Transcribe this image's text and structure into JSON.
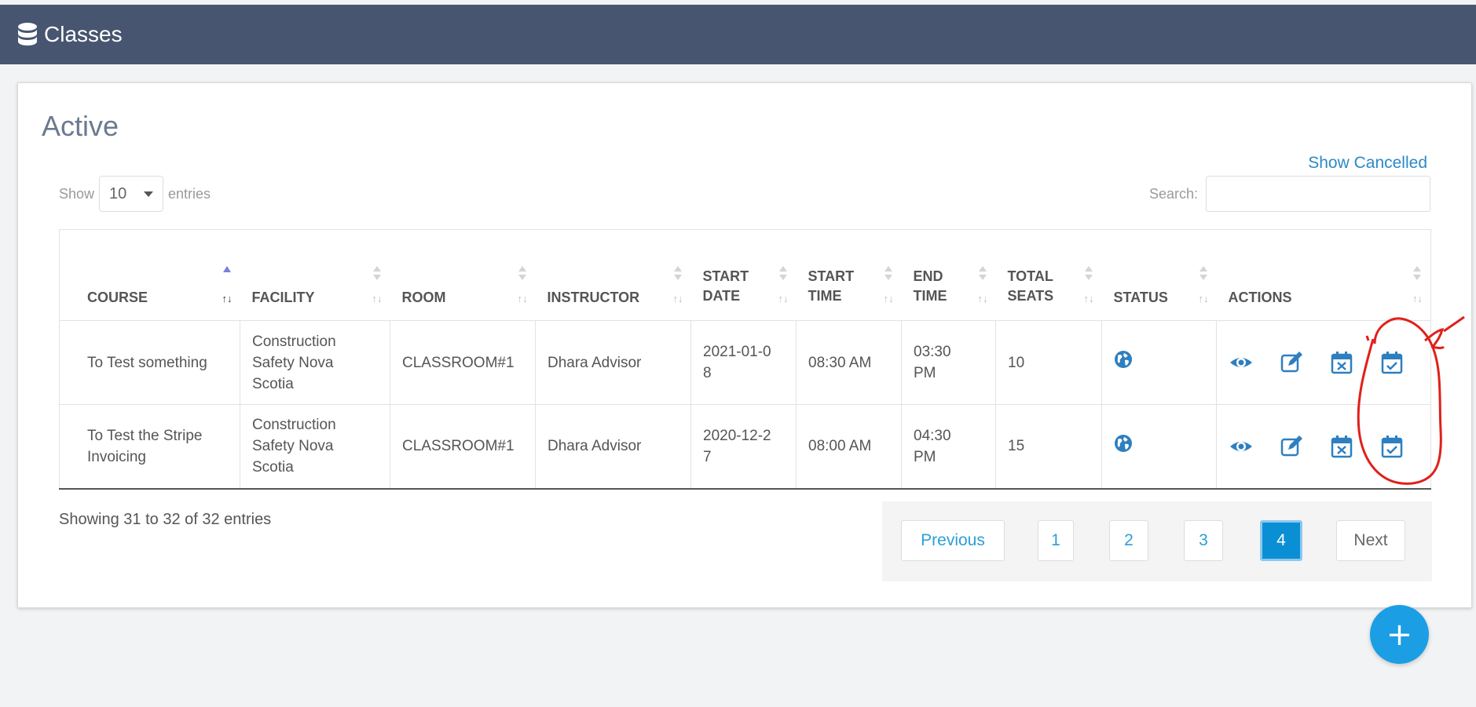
{
  "header": {
    "title": "Classes",
    "icon": "database-icon"
  },
  "card": {
    "title": "Active",
    "show_cancelled_label": "Show Cancelled",
    "length": {
      "show_label": "Show",
      "value": "10",
      "entries_label": "entries"
    },
    "search": {
      "label": "Search:",
      "value": "",
      "placeholder": ""
    }
  },
  "table": {
    "columns": [
      "COURSE",
      "FACILITY",
      "ROOM",
      "INSTRUCTOR",
      "START DATE",
      "START TIME",
      "END TIME",
      "TOTAL SEATS",
      "STATUS",
      "ACTIONS"
    ],
    "rows": [
      {
        "course": "To Test something",
        "facility": "Construction Safety Nova Scotia",
        "room": "CLASSROOM#1",
        "instructor": "Dhara Advisor",
        "start_date": "2021-01-08",
        "start_time": "08:30 AM",
        "end_time": "03:30 PM",
        "total_seats": "10"
      },
      {
        "course": "To Test the Stripe Invoicing",
        "facility": "Construction Safety Nova Scotia",
        "room": "CLASSROOM#1",
        "instructor": "Dhara Advisor",
        "start_date": "2020-12-27",
        "start_time": "08:00 AM",
        "end_time": "04:30 PM",
        "total_seats": "15"
      }
    ]
  },
  "info": "Showing 31 to 32 of 32 entries",
  "pagination": {
    "previous": "Previous",
    "pages": [
      "1",
      "2",
      "3",
      "4"
    ],
    "current": "4",
    "next": "Next"
  },
  "fab_label": "+",
  "colors": {
    "header_bg": "#475570",
    "accent": "#2b8ac6",
    "active_page": "#0a8fd4",
    "fab": "#1b9ee4",
    "annotation": "#e0201a"
  }
}
